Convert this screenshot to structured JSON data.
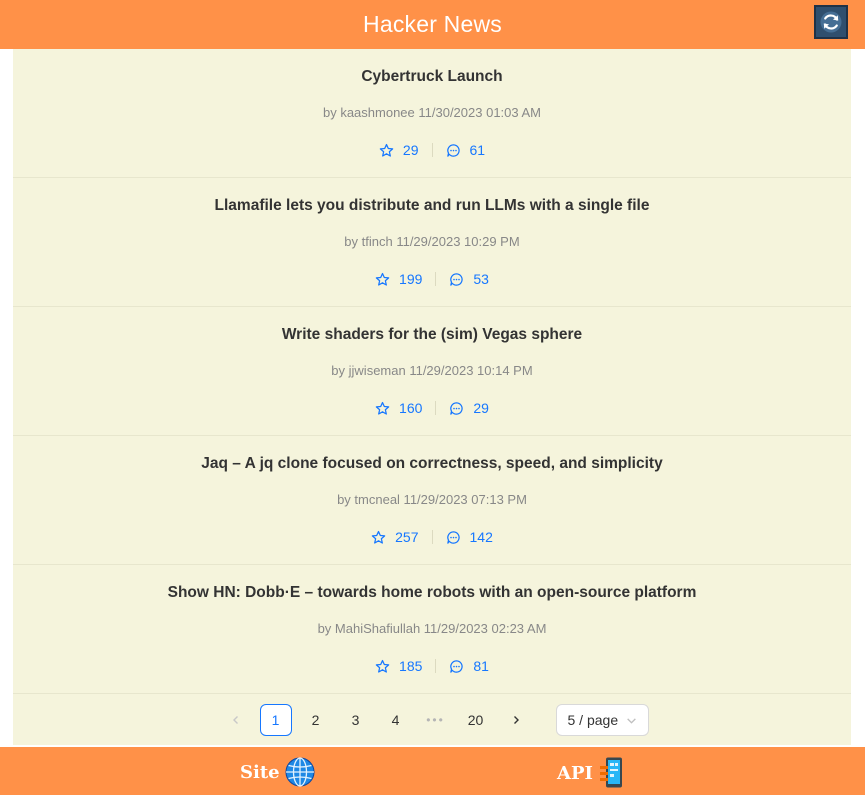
{
  "header": {
    "title": "Hacker News",
    "refresh_icon": "refresh-icon"
  },
  "stories": [
    {
      "title": "Cybertruck Launch",
      "meta": "by kaashmonee 11/30/2023 01:03 AM",
      "score": "29",
      "comments": "61"
    },
    {
      "title": "Llamafile lets you distribute and run LLMs with a single file",
      "meta": "by tfinch 11/29/2023 10:29 PM",
      "score": "199",
      "comments": "53"
    },
    {
      "title": "Write shaders for the (sim) Vegas sphere",
      "meta": "by jjwiseman 11/29/2023 10:14 PM",
      "score": "160",
      "comments": "29"
    },
    {
      "title": "Jaq – A jq clone focused on correctness, speed, and simplicity",
      "meta": "by tmcneal 11/29/2023 07:13 PM",
      "score": "257",
      "comments": "142"
    },
    {
      "title": "Show HN: Dobb·E – towards home robots with an open-source platform",
      "meta": "by MahiShafiullah 11/29/2023 02:23 AM",
      "score": "185",
      "comments": "81"
    }
  ],
  "pagination": {
    "pages": [
      "1",
      "2",
      "3",
      "4"
    ],
    "ellipsis": "•••",
    "last": "20",
    "current": "1",
    "page_size": "5 / page"
  },
  "footer": {
    "site_label": "Site",
    "api_label": "API"
  },
  "colors": {
    "accent": "#ff9148",
    "link": "#1677ff",
    "card": "#f5f4dc"
  }
}
